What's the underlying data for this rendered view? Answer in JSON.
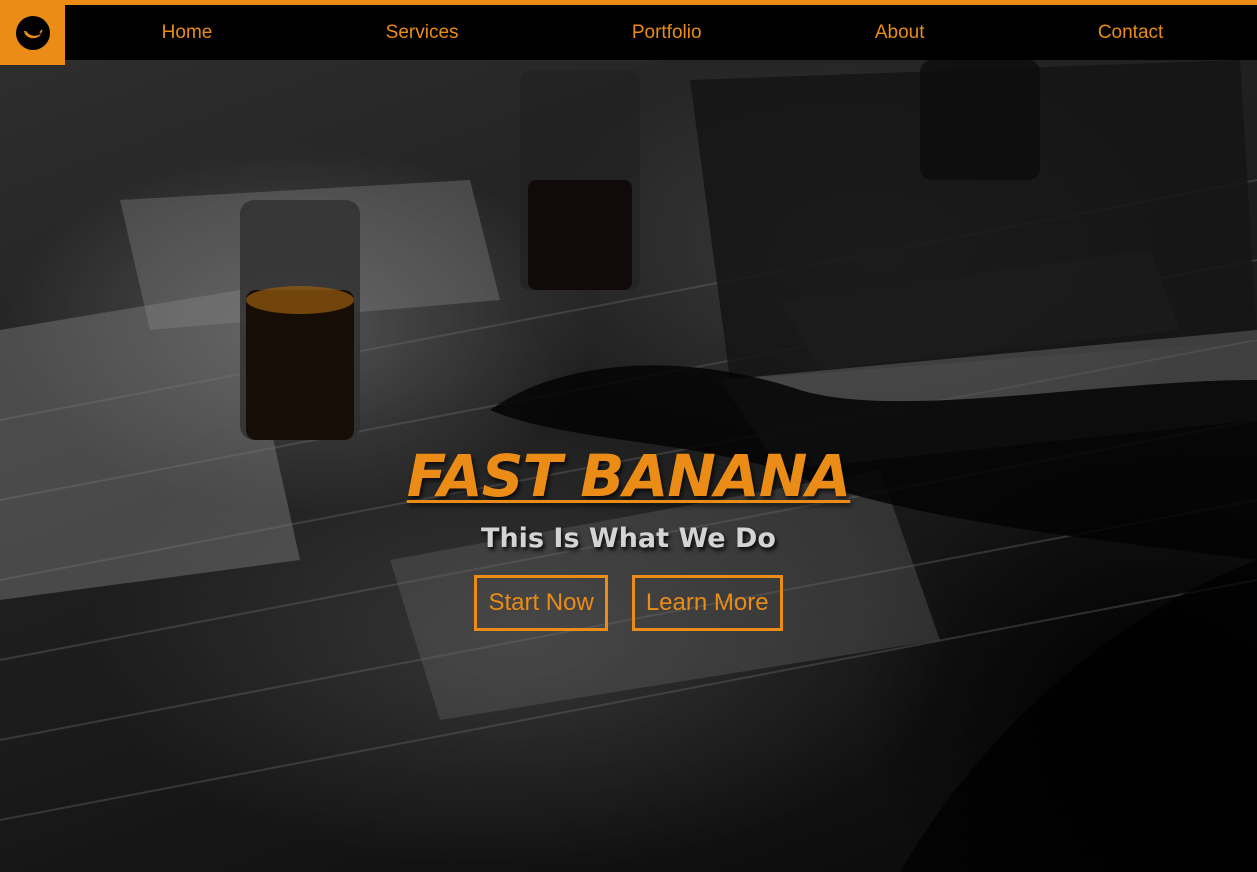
{
  "header": {
    "logo_icon": "banana-icon",
    "nav": [
      {
        "label": "Home"
      },
      {
        "label": "Services"
      },
      {
        "label": "Portfolio"
      },
      {
        "label": "About"
      },
      {
        "label": "Contact"
      }
    ]
  },
  "hero": {
    "title": "FAST BANANA",
    "subtitle": "This Is What We Do",
    "buttons": {
      "primary_label": "Start Now",
      "secondary_label": "Learn More"
    },
    "background_image": "desaturated workspace photo"
  },
  "colors": {
    "accent": "#ea8c15",
    "topbar_bg": "#000000",
    "subtitle_text": "#d4d4d4"
  }
}
